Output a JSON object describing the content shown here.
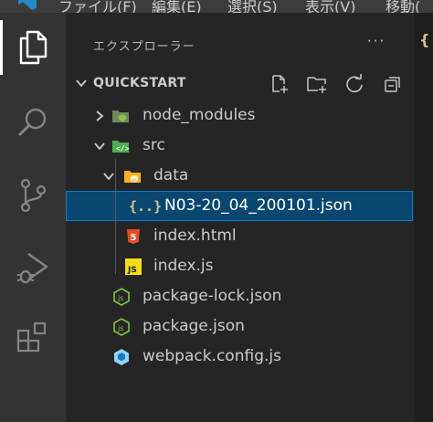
{
  "menubar": {
    "items": [
      "ファイル(F)",
      "編集(E)",
      "選択(S)",
      "表示(V)",
      "移動("
    ]
  },
  "activity_bar": {
    "items": [
      {
        "name": "explorer",
        "icon": "files-icon",
        "active": true
      },
      {
        "name": "search",
        "icon": "search-icon",
        "active": false
      },
      {
        "name": "source-control",
        "icon": "source-control-icon",
        "active": false
      },
      {
        "name": "run-debug",
        "icon": "run-debug-icon",
        "active": false
      },
      {
        "name": "extensions",
        "icon": "extensions-icon",
        "active": false
      }
    ]
  },
  "sidebar": {
    "title": "エクスプローラー",
    "more_actions": "···",
    "section": {
      "title": "QUICKSTART",
      "actions": [
        "new-file-icon",
        "new-folder-icon",
        "refresh-icon",
        "collapse-all-icon"
      ]
    },
    "tree": [
      {
        "label": "node_modules",
        "type": "folder",
        "expanded": false,
        "icon": "node-modules-folder-icon"
      },
      {
        "label": "src",
        "type": "folder",
        "expanded": true,
        "icon": "src-folder-icon"
      },
      {
        "label": "data",
        "type": "folder",
        "expanded": true,
        "icon": "data-folder-icon"
      },
      {
        "label": "N03-20_04_200101.json",
        "type": "file",
        "selected": true,
        "icon": "json-file-icon"
      },
      {
        "label": "index.html",
        "type": "file",
        "icon": "html5-icon"
      },
      {
        "label": "index.js",
        "type": "file",
        "icon": "js-file-icon"
      },
      {
        "label": "package-lock.json",
        "type": "file",
        "icon": "nodejs-icon"
      },
      {
        "label": "package.json",
        "type": "file",
        "icon": "nodejs-icon"
      },
      {
        "label": "webpack.config.js",
        "type": "file",
        "icon": "webpack-icon"
      }
    ]
  },
  "editor": {
    "tab_icon": "{"
  },
  "colors": {
    "activity_bg": "#333333",
    "sidebar_bg": "#252526",
    "selection_bg": "#094771",
    "selection_border": "#007fd4",
    "json_icon": "#e2c08d",
    "html_icon": "#e44d26",
    "js_icon": "#f5de19",
    "node_green": "#8bc34a",
    "webpack_blue": "#8ed6fb"
  }
}
